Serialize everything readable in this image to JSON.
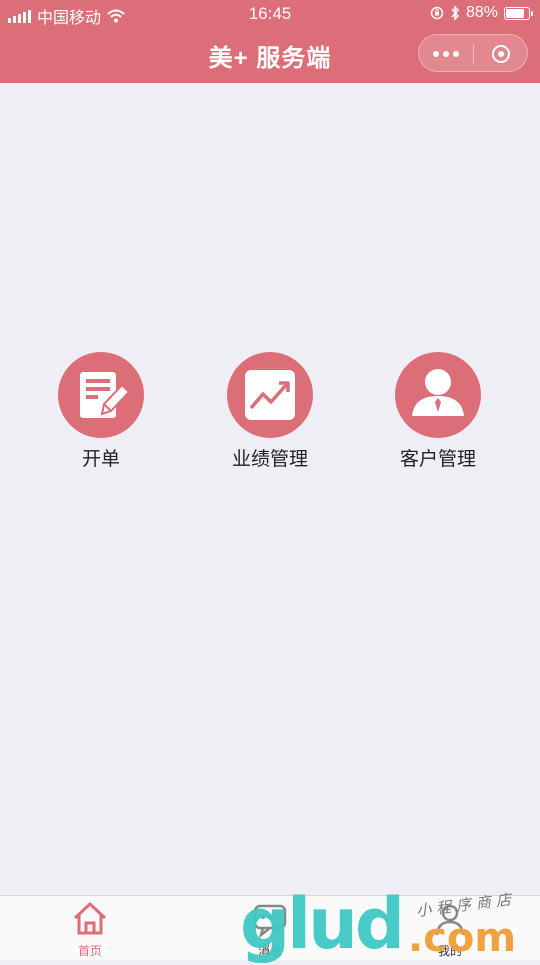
{
  "status_bar": {
    "carrier": "中国移动",
    "time": "16:45",
    "battery_text": "88%",
    "battery_level": 0.88,
    "icons": [
      "signal-icon",
      "wifi-icon",
      "orientation-lock-icon",
      "bluetooth-icon",
      "battery-icon"
    ]
  },
  "header": {
    "title": "美+ 服务端",
    "capsule": {
      "more_icon": "more-dots-icon",
      "close_icon": "close-miniprogram-icon"
    }
  },
  "menu": [
    {
      "label": "开单",
      "icon": "order-form-icon"
    },
    {
      "label": "业绩管理",
      "icon": "trend-chart-icon"
    },
    {
      "label": "客户管理",
      "icon": "customer-person-icon"
    }
  ],
  "tabbar": [
    {
      "label": "首页",
      "icon": "home-icon",
      "active": true
    },
    {
      "label": "消息",
      "icon": "message-icon",
      "active": false
    },
    {
      "label": "我的",
      "icon": "profile-icon",
      "active": false
    }
  ],
  "watermark": {
    "logo": "glud",
    "domain": ".com",
    "caption": "小程序商店"
  },
  "colors": {
    "accent": "#dc6e78",
    "page_bg": "#efeef4",
    "tabbar_bg": "#fafafa"
  }
}
